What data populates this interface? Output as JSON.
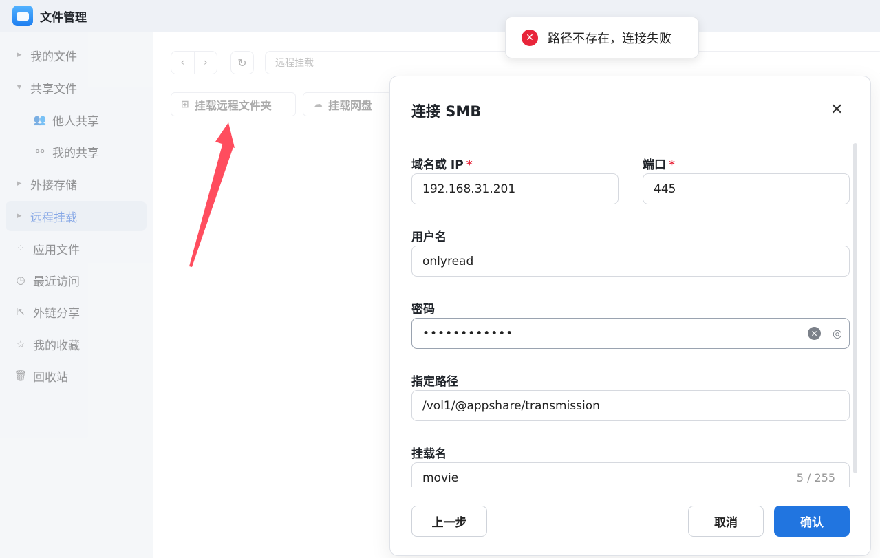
{
  "app": {
    "title": "文件管理"
  },
  "sidebar": {
    "items": [
      {
        "label": "我的文件",
        "icon": "caret-right-icon"
      },
      {
        "label": "共享文件",
        "icon": "caret-down-icon"
      },
      {
        "label": "他人共享",
        "icon": "users-icon"
      },
      {
        "label": "我的共享",
        "icon": "share-nodes-icon"
      },
      {
        "label": "外接存储",
        "icon": "caret-right-icon"
      },
      {
        "label": "远程挂载",
        "icon": "caret-right-icon",
        "active": true
      },
      {
        "label": "应用文件",
        "icon": "apps-grid-icon"
      },
      {
        "label": "最近访问",
        "icon": "clock-icon"
      },
      {
        "label": "外链分享",
        "icon": "external-share-icon"
      },
      {
        "label": "我的收藏",
        "icon": "star-icon"
      },
      {
        "label": "回收站",
        "icon": "trash-icon"
      }
    ]
  },
  "toolbar": {
    "path_placeholder": "远程挂载",
    "mount_folder_label": "挂载远程文件夹",
    "mount_cloud_label": "挂载网盘"
  },
  "toast": {
    "message": "路径不存在，连接失败",
    "type": "error"
  },
  "dialog": {
    "title": "连接 SMB",
    "fields": {
      "host": {
        "label": "域名或 IP",
        "required": true,
        "value": "192.168.31.201"
      },
      "port": {
        "label": "端口",
        "required": true,
        "value": "445"
      },
      "username": {
        "label": "用户名",
        "value": "onlyread"
      },
      "password": {
        "label": "密码",
        "value": "••••••••••••"
      },
      "path": {
        "label": "指定路径",
        "value": "/vol1/@appshare/transmission"
      },
      "mount_name": {
        "label": "挂载名",
        "value": "movie",
        "counter": "5 / 255"
      }
    },
    "buttons": {
      "back": "上一步",
      "cancel": "取消",
      "confirm": "确认"
    }
  },
  "colors": {
    "accent": "#2175e0",
    "error": "#e8253a",
    "annotation_arrow": "#ff4d5e"
  }
}
